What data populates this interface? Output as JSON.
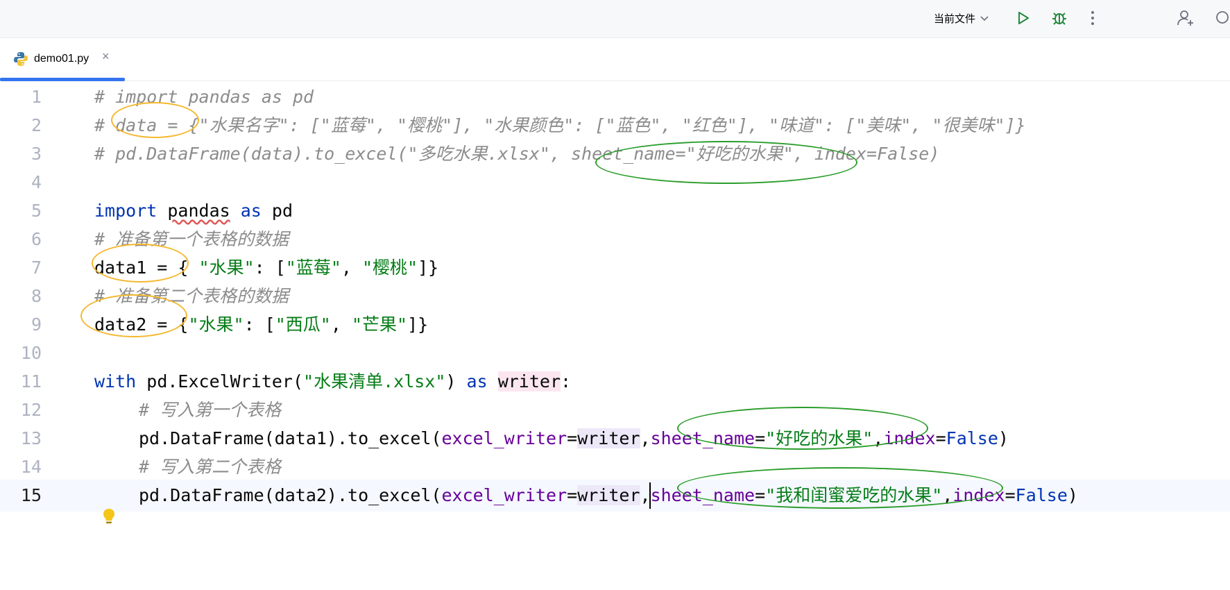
{
  "toolbar": {
    "run_config": "当前文件",
    "icons": [
      "chevron-down-icon",
      "run-icon",
      "debug-icon",
      "more-vertical-icon",
      "add-user-icon",
      "search-icon"
    ]
  },
  "tabs": [
    {
      "label": "demo01.py",
      "icon": "python-file-icon",
      "active": true
    }
  ],
  "colors": {
    "accent": "#3574f0",
    "keyword": "#0033b3",
    "string": "#067d17",
    "comment": "#8c8c8c",
    "param": "#660099",
    "annotation_yellow": "#f5b82e",
    "annotation_green": "#2a9d2a"
  },
  "editor": {
    "current_line": 15,
    "lines": [
      {
        "num": "1",
        "text": "# import pandas as pd"
      },
      {
        "num": "2",
        "text": "# data = {\"水果名字\": [\"蓝莓\", \"樱桃\"], \"水果颜色\": [\"蓝色\", \"红色\"], \"味道\": [\"美味\", \"很美味\"]}"
      },
      {
        "num": "3",
        "text": "# pd.DataFrame(data).to_excel(\"多吃水果.xlsx\", sheet_name=\"好吃的水果\", index=False)"
      },
      {
        "num": "4",
        "text": ""
      },
      {
        "num": "5",
        "text": "import pandas as pd"
      },
      {
        "num": "6",
        "text": "# 准备第一个表格的数据"
      },
      {
        "num": "7",
        "text": "data1 = { \"水果\": [\"蓝莓\", \"樱桃\"]}"
      },
      {
        "num": "8",
        "text": "# 准备第二个表格的数据"
      },
      {
        "num": "9",
        "text": "data2 = {\"水果\": [\"西瓜\", \"芒果\"]}"
      },
      {
        "num": "10",
        "text": ""
      },
      {
        "num": "11",
        "text": "with pd.ExcelWriter(\"水果清单.xlsx\") as writer:"
      },
      {
        "num": "12",
        "text": "    # 写入第一个表格"
      },
      {
        "num": "13",
        "text": "    pd.DataFrame(data1).to_excel(excel_writer=writer,sheet_name=\"好吃的水果\",index=False)"
      },
      {
        "num": "14",
        "text": "    # 写入第二个表格"
      },
      {
        "num": "15",
        "text": "    pd.DataFrame(data2).to_excel(excel_writer=writer,sheet_name=\"我和闺蜜爱吃的水果\",index=False)"
      }
    ]
  },
  "tokens": {
    "l1": "# import pandas as pd",
    "l2": "# data = {\"水果名字\": [\"蓝莓\", \"樱桃\"], \"水果颜色\": [\"蓝色\", \"红色\"], \"味道\": [\"美味\", \"很美味\"]}",
    "l3": "# pd.DataFrame(data).to_excel(\"多吃水果.xlsx\", sheet_name=\"好吃的水果\", index=False)",
    "l5_import": "import",
    "l5_pandas": "pandas",
    "l5_as": "as",
    "l5_pd": "pd",
    "l6": "# 准备第一个表格的数据",
    "l7_var": "data1 = { ",
    "l7_key": "\"水果\"",
    "l7_mid": ": [",
    "l7_v1": "\"蓝莓\"",
    "l7_sep": ", ",
    "l7_v2": "\"樱桃\"",
    "l7_end": "]}",
    "l8": "# 准备第二个表格的数据",
    "l9_var": "data2 = {",
    "l9_key": "\"水果\"",
    "l9_mid": ": [",
    "l9_v1": "\"西瓜\"",
    "l9_sep": ", ",
    "l9_v2": "\"芒果\"",
    "l9_end": "]}",
    "l11_with": "with",
    "l11_call": " pd.ExcelWriter(",
    "l11_str": "\"水果清单.xlsx\"",
    "l11_close": ") ",
    "l11_as": "as",
    "l11_sp": " ",
    "l11_writer": "writer",
    "l11_colon": ":",
    "l12": "# 写入第一个表格",
    "l13_call": "pd.DataFrame(data1).to_excel(",
    "l13_p1": "excel_writer",
    "l13_eq1": "=",
    "l13_writer": "writer",
    "l13_comma1": ",",
    "l13_p2": "sheet_name",
    "l13_eq2": "=",
    "l13_str": "\"好吃的水果\"",
    "l13_comma2": ",",
    "l13_p3": "index",
    "l13_eq3": "=",
    "l13_false": "False",
    "l13_close": ")",
    "l14": "# 写入第二个表格",
    "l15_call": "pd.DataFrame(data2).to_excel(",
    "l15_p1": "excel_writer",
    "l15_eq1": "=",
    "l15_writer": "writer",
    "l15_comma1": ",",
    "l15_p2": "sheet_name",
    "l15_eq2": "=",
    "l15_str": "\"我和闺蜜爱吃的水果\"",
    "l15_comma2": ",",
    "l15_p3": "index",
    "l15_eq3": "=",
    "l15_false": "False",
    "l15_close": ")"
  }
}
